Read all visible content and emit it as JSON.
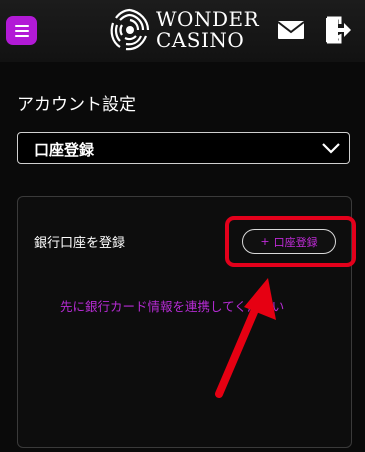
{
  "header": {
    "brand_line1": "WONDER",
    "brand_line2": "CASINO",
    "icons": {
      "menu": "hamburger-icon",
      "mail": "mail-icon",
      "logout": "logout-icon"
    }
  },
  "page": {
    "title": "アカウント設定"
  },
  "select": {
    "value": "口座登録",
    "icon": "chevron-down-icon"
  },
  "bank": {
    "label": "銀行口座を登録",
    "add_button_plus": "+",
    "add_button_label": "口座登録",
    "notice": "先に銀行カード情報を連携してください"
  },
  "colors": {
    "accent": "#b21ad6",
    "notice_text": "#b52bd3",
    "annotation_red": "#e3001b",
    "background": "#0a0a0a"
  }
}
